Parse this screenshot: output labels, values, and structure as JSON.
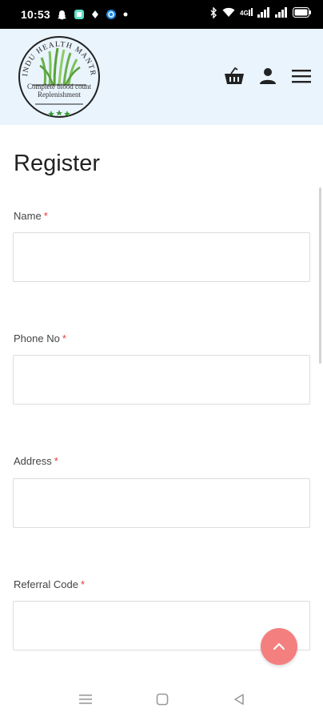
{
  "status_bar": {
    "time": "10:53",
    "icons": [
      "snapchat-icon",
      "app-icon",
      "dot-icon",
      "browser-icon",
      "more-dot-icon",
      "bluetooth-icon",
      "wifi-icon",
      "volte-icon",
      "signal-icon",
      "signal-icon",
      "battery-icon"
    ]
  },
  "header": {
    "logo_text_top": "HINDU HEALTH MANTRA",
    "logo_text_line1": "Complete blood count",
    "logo_text_line2": "Replenishment",
    "icons": [
      "basket-icon",
      "user-icon",
      "menu-icon"
    ]
  },
  "form": {
    "title": "Register",
    "fields": [
      {
        "label": "Name",
        "required_mark": "*",
        "value": ""
      },
      {
        "label": "Phone No",
        "required_mark": "*",
        "value": ""
      },
      {
        "label": "Address",
        "required_mark": "*",
        "value": ""
      },
      {
        "label": "Referral Code",
        "required_mark": "*",
        "value": ""
      }
    ]
  },
  "colors": {
    "header_bg": "#eaf4fd",
    "required": "#e53935",
    "fab": "#f47f7f"
  },
  "nav_bar": {
    "icons": [
      "recents-icon",
      "home-icon",
      "back-icon"
    ]
  }
}
